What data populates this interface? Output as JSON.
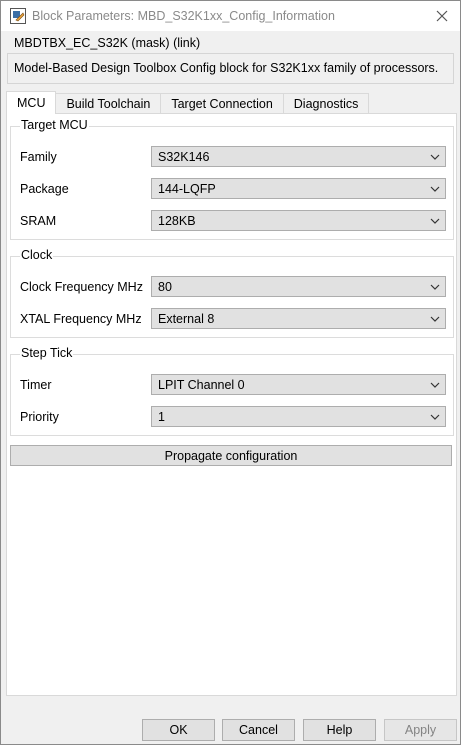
{
  "window": {
    "title": "Block Parameters: MBD_S32K1xx_Config_Information",
    "icon": "block-parameters-icon",
    "close_icon": "close-icon"
  },
  "mask": {
    "name": "MBDTBX_EC_S32K (mask) (link)",
    "description": "Model-Based Design Toolbox Config block for S32K1xx family of processors."
  },
  "tabs": [
    {
      "label": "MCU",
      "active": true
    },
    {
      "label": "Build Toolchain",
      "active": false
    },
    {
      "label": "Target Connection",
      "active": false
    },
    {
      "label": "Diagnostics",
      "active": false
    }
  ],
  "groups": {
    "target_mcu": {
      "title": "Target MCU",
      "params": [
        {
          "label": "Family",
          "value": "S32K146"
        },
        {
          "label": "Package",
          "value": "144-LQFP"
        },
        {
          "label": "SRAM",
          "value": "128KB"
        }
      ]
    },
    "clock": {
      "title": "Clock",
      "params": [
        {
          "label": "Clock Frequency MHz",
          "value": "80"
        },
        {
          "label": "XTAL Frequency MHz",
          "value": "External 8"
        }
      ]
    },
    "step_tick": {
      "title": "Step Tick",
      "params": [
        {
          "label": "Timer",
          "value": "LPIT Channel 0"
        },
        {
          "label": "Priority",
          "value": "1"
        }
      ]
    }
  },
  "propagate_label": "Propagate configuration",
  "buttons": {
    "ok": "OK",
    "cancel": "Cancel",
    "help": "Help",
    "apply": "Apply"
  },
  "colors": {
    "disabled_text": "#838383",
    "control_bg": "#e1e1e1"
  }
}
